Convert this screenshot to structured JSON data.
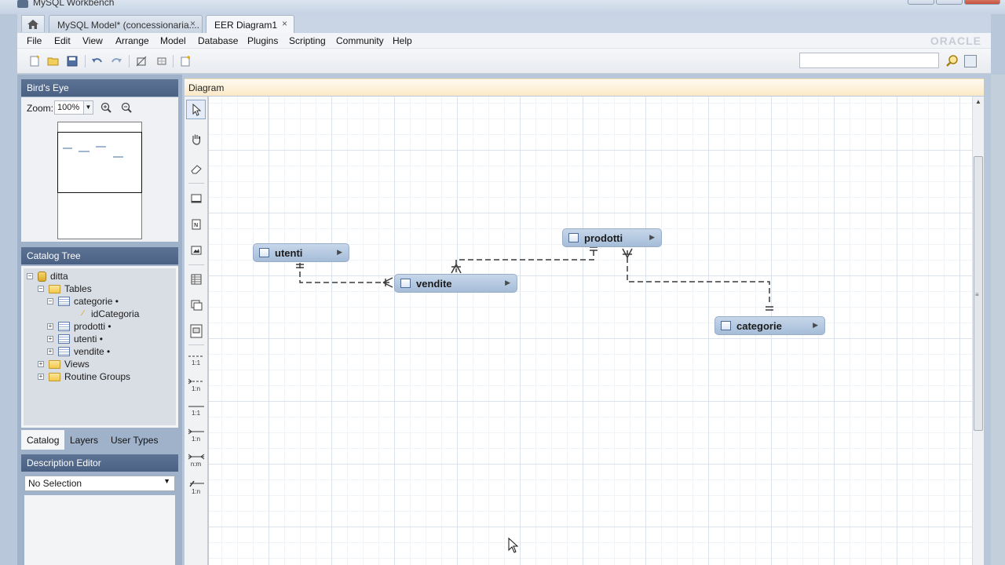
{
  "window": {
    "title": "MySQL Workbench"
  },
  "tabs": [
    {
      "label": "MySQL Model* (concessionaria....",
      "close": "×"
    },
    {
      "label": "EER Diagram1",
      "close": "×"
    }
  ],
  "menu": [
    "File",
    "Edit",
    "View",
    "Arrange",
    "Model",
    "Database",
    "Plugins",
    "Scripting",
    "Community",
    "Help"
  ],
  "brand": "ORACLE",
  "toolbar": {
    "search_value": ""
  },
  "birds_eye": {
    "title": "Bird's Eye",
    "zoom_label": "Zoom:",
    "zoom_value": "100%"
  },
  "catalog_tree": {
    "title": "Catalog Tree",
    "schema": "ditta",
    "tables_folder": "Tables",
    "items": [
      "categorie •",
      "idCategoria",
      "prodotti •",
      "utenti •",
      "vendite •"
    ],
    "views": "Views",
    "routine_groups": "Routine Groups"
  },
  "sidebar_tabs": [
    "Catalog",
    "Layers",
    "User Types"
  ],
  "description_editor": {
    "title": "Description Editor",
    "selection": "No Selection"
  },
  "diagram": {
    "title": "Diagram",
    "tool_labels": {
      "one_to_one_a": "1:1",
      "one_to_many_a": "1:n",
      "one_to_one_b": "1:1",
      "one_to_many_b": "1:n",
      "many_to_many": "n:m",
      "one_to_many_existing": "1:n"
    },
    "entities": {
      "utenti": "utenti",
      "vendite": "vendite",
      "prodotti": "prodotti",
      "categorie": "categorie"
    },
    "expand_glyph": "▶"
  }
}
